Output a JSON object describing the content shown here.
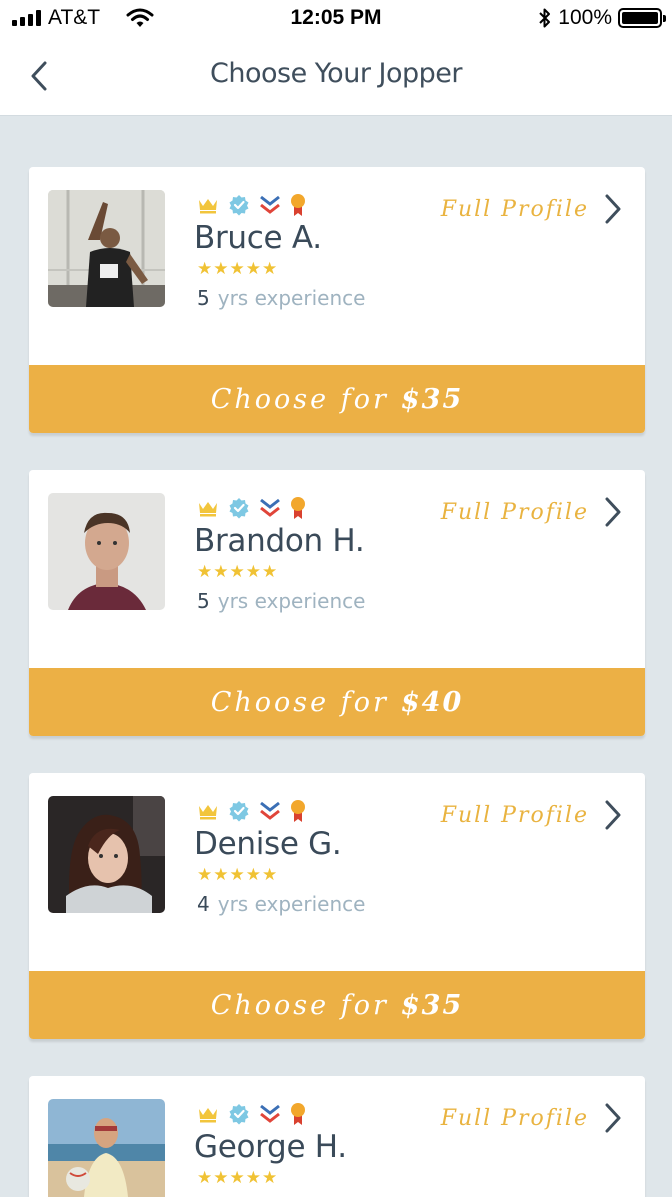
{
  "status_bar": {
    "carrier": "AT&T",
    "time": "12:05 PM",
    "battery": "100%"
  },
  "nav": {
    "title": "Choose Your Jopper",
    "back_icon": "chevron-left-icon"
  },
  "badge_icons": [
    "crown-icon",
    "verified-check-icon",
    "chevrons-icon",
    "ribbon-medal-icon"
  ],
  "colors": {
    "accent": "#ecb045",
    "profile_link": "#e9b340",
    "stars": "#f0c234",
    "background": "#dfe6ea",
    "name_text": "#3a4a59"
  },
  "joppers": [
    {
      "name": "Bruce A.",
      "stars": "★★★★★",
      "rating": 5,
      "years": "5",
      "experience_label": "yrs experience",
      "full_profile_label": "Full Profile",
      "choose_label": "Choose for",
      "price": "$35"
    },
    {
      "name": "Brandon H.",
      "stars": "★★★★★",
      "rating": 5,
      "years": "5",
      "experience_label": "yrs experience",
      "full_profile_label": "Full Profile",
      "choose_label": "Choose for",
      "price": "$40"
    },
    {
      "name": "Denise G.",
      "stars": "★★★★★",
      "rating": 5,
      "years": "4",
      "experience_label": "yrs experience",
      "full_profile_label": "Full Profile",
      "choose_label": "Choose for",
      "price": "$35"
    },
    {
      "name": "George H.",
      "stars": "★★★★★",
      "rating": 5,
      "full_profile_label": "Full Profile"
    }
  ]
}
